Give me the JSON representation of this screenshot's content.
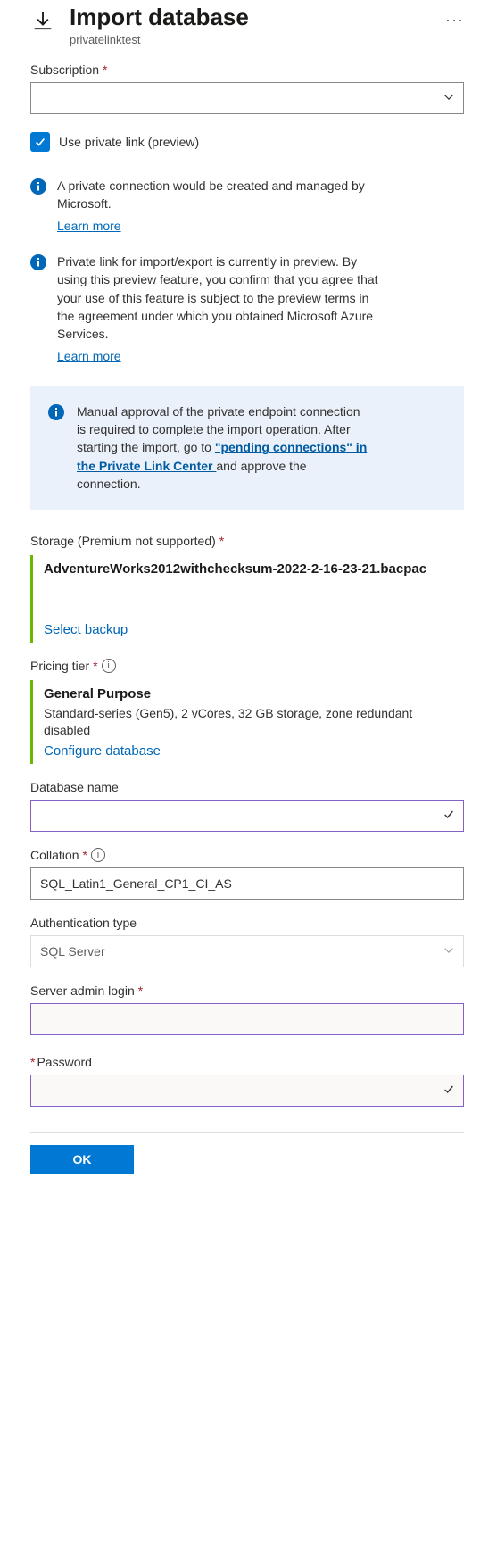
{
  "header": {
    "title": "Import database",
    "subtitle": "privatelinktest"
  },
  "subscription": {
    "label": "Subscription",
    "value": ""
  },
  "use_private_link": {
    "checked": true,
    "label": "Use private link (preview)"
  },
  "info_private_conn": {
    "text": "A private connection would be created and managed by Microsoft.",
    "learn_more": "Learn more"
  },
  "info_preview": {
    "text": "Private link for import/export is currently in preview. By using this preview feature, you confirm that you agree that your use of this feature is subject to the preview terms in the agreement under which you obtained Microsoft Azure Services.",
    "learn_more": "Learn more"
  },
  "manual_approval": {
    "text_before": "Manual approval of the private endpoint connection is required to complete the import operation. After starting the import, go to ",
    "link_text": "\"pending connections\" in the Private Link Center ",
    "text_after": "and approve the connection."
  },
  "storage": {
    "label": "Storage (Premium not supported)",
    "filename": "AdventureWorks2012withchecksum-2022-2-16-23-21.bacpac",
    "action": "Select backup"
  },
  "pricing": {
    "label": "Pricing tier",
    "tier_name": "General Purpose",
    "tier_desc": "Standard-series (Gen5), 2 vCores, 32 GB storage, zone redundant disabled",
    "action": "Configure database"
  },
  "db_name": {
    "label": "Database name",
    "value": ""
  },
  "collation": {
    "label": "Collation",
    "value": "SQL_Latin1_General_CP1_CI_AS"
  },
  "auth_type": {
    "label": "Authentication type",
    "value": "SQL Server"
  },
  "admin_login": {
    "label": "Server admin login",
    "value": ""
  },
  "password": {
    "label": "Password",
    "value": ""
  },
  "footer": {
    "ok": "OK"
  }
}
